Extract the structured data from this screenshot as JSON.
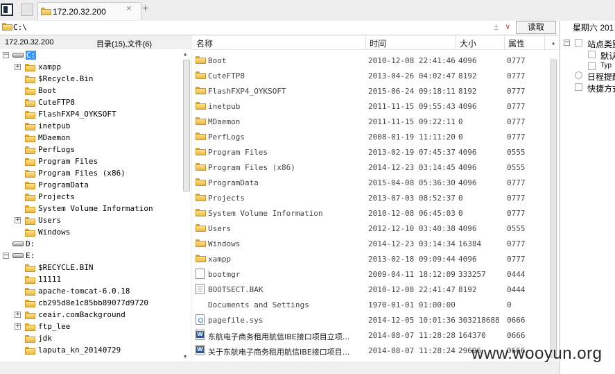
{
  "tabbar": {
    "active_tab_title": "172.20.32.200",
    "close_symbol": "×",
    "add_symbol": "+"
  },
  "pathbar": {
    "path": "C:\\",
    "add_symbol": "±",
    "dropdown_symbol": "∨",
    "read_button": "读取"
  },
  "left_pane": {
    "server": "172.20.32.200",
    "summary": "目录(15),文件(6)",
    "tree": [
      {
        "label": "C:",
        "type": "drive",
        "level": 0,
        "expander": "−",
        "selected": true
      },
      {
        "label": "xampp",
        "type": "folder",
        "level": 1,
        "expander": "+"
      },
      {
        "label": "$Recycle.Bin",
        "type": "folder",
        "level": 1
      },
      {
        "label": "Boot",
        "type": "folder",
        "level": 1
      },
      {
        "label": "CuteFTP8",
        "type": "folder",
        "level": 1
      },
      {
        "label": "FlashFXP4_OYKSOFT",
        "type": "folder",
        "level": 1
      },
      {
        "label": "inetpub",
        "type": "folder",
        "level": 1
      },
      {
        "label": "MDaemon",
        "type": "folder",
        "level": 1
      },
      {
        "label": "PerfLogs",
        "type": "folder",
        "level": 1
      },
      {
        "label": "Program Files",
        "type": "folder",
        "level": 1
      },
      {
        "label": "Program Files (x86)",
        "type": "folder",
        "level": 1
      },
      {
        "label": "ProgramData",
        "type": "folder",
        "level": 1
      },
      {
        "label": "Projects",
        "type": "folder",
        "level": 1
      },
      {
        "label": "System Volume Information",
        "type": "folder",
        "level": 1
      },
      {
        "label": "Users",
        "type": "folder",
        "level": 1,
        "expander": "+"
      },
      {
        "label": "Windows",
        "type": "folder",
        "level": 1
      },
      {
        "label": "D:",
        "type": "drive",
        "level": 0
      },
      {
        "label": "E:",
        "type": "drive",
        "level": 0,
        "expander": "−"
      },
      {
        "label": "$RECYCLE.BIN",
        "type": "folder",
        "level": 1
      },
      {
        "label": "11111",
        "type": "folder",
        "level": 1
      },
      {
        "label": "apache-tomcat-6.0.18",
        "type": "folder",
        "level": 1
      },
      {
        "label": "cb295d8e1c85bb89077d9720",
        "type": "folder",
        "level": 1
      },
      {
        "label": "ceair.comBackground",
        "type": "folder",
        "level": 1,
        "expander": "+"
      },
      {
        "label": "ftp_lee",
        "type": "folder",
        "level": 1,
        "expander": "+"
      },
      {
        "label": "jdk",
        "type": "folder",
        "level": 1
      },
      {
        "label": "laputa_kn_20140729",
        "type": "folder",
        "level": 1
      }
    ]
  },
  "file_list": {
    "columns": {
      "name": "名称",
      "time": "时间",
      "size": "大小",
      "attr": "属性"
    },
    "rows": [
      {
        "name": "Boot",
        "time": "2010-12-08 22:41:46",
        "size": "4096",
        "attr": "0777",
        "icon": "folder"
      },
      {
        "name": "CuteFTP8",
        "time": "2013-04-26 04:02:47",
        "size": "8192",
        "attr": "0777",
        "icon": "folder"
      },
      {
        "name": "FlashFXP4_OYKSOFT",
        "time": "2015-06-24 09:18:11",
        "size": "8192",
        "attr": "0777",
        "icon": "folder"
      },
      {
        "name": "inetpub",
        "time": "2011-11-15 09:55:43",
        "size": "4096",
        "attr": "0777",
        "icon": "folder"
      },
      {
        "name": "MDaemon",
        "time": "2011-11-15 09:22:11",
        "size": "0",
        "attr": "0777",
        "icon": "folder"
      },
      {
        "name": "PerfLogs",
        "time": "2008-01-19 11:11:20",
        "size": "0",
        "attr": "0777",
        "icon": "folder"
      },
      {
        "name": "Program Files",
        "time": "2013-02-19 07:45:37",
        "size": "4096",
        "attr": "0555",
        "icon": "folder"
      },
      {
        "name": "Program Files (x86)",
        "time": "2014-12-23 03:14:45",
        "size": "4096",
        "attr": "0555",
        "icon": "folder"
      },
      {
        "name": "ProgramData",
        "time": "2015-04-08 05:36:30",
        "size": "4096",
        "attr": "0777",
        "icon": "folder"
      },
      {
        "name": "Projects",
        "time": "2013-07-03 08:52:37",
        "size": "0",
        "attr": "0777",
        "icon": "folder"
      },
      {
        "name": "System Volume Information",
        "time": "2010-12-08 06:45:03",
        "size": "0",
        "attr": "0777",
        "icon": "folder"
      },
      {
        "name": "Users",
        "time": "2012-12-10 03:40:38",
        "size": "4096",
        "attr": "0555",
        "icon": "folder"
      },
      {
        "name": "Windows",
        "time": "2014-12-23 03:14:34",
        "size": "16384",
        "attr": "0777",
        "icon": "folder"
      },
      {
        "name": "xampp",
        "time": "2013-02-18 09:09:44",
        "size": "4096",
        "attr": "0777",
        "icon": "folder"
      },
      {
        "name": "bootmgr",
        "time": "2009-04-11 18:12:09",
        "size": "333257",
        "attr": "0444",
        "icon": "file"
      },
      {
        "name": "BOOTSECT.BAK",
        "time": "2010-12-08 22:41:47",
        "size": "8192",
        "attr": "0444",
        "icon": "bak"
      },
      {
        "name": "Documents and Settings",
        "time": "1970-01-01 01:00:00",
        "size": "",
        "attr": "0",
        "icon": "none"
      },
      {
        "name": "pagefile.sys",
        "time": "2014-12-05 10:01:36",
        "size": "303218688",
        "attr": "0666",
        "icon": "sys"
      },
      {
        "name": "东航电子商务租用航信IBE接口项目立项...",
        "time": "2014-08-07 11:28:28",
        "size": "164370",
        "attr": "0666",
        "icon": "doc"
      },
      {
        "name": "关于东航电子商务租用航信IBE接口项目...",
        "time": "2014-08-07 11:28:24",
        "size": "29696",
        "attr": "0666",
        "icon": "doc"
      }
    ]
  },
  "side_panel": {
    "date": "星期六 201",
    "items": [
      {
        "label": "站点类别",
        "type": "tree-root",
        "expander": "−"
      },
      {
        "label": "默认",
        "type": "checkbox"
      },
      {
        "label": "Typ",
        "type": "checkbox"
      },
      {
        "label": "日程提醒",
        "type": "tool"
      },
      {
        "label": "快捷方式",
        "type": "tool"
      }
    ]
  },
  "watermark": "www.wooyun.org"
}
